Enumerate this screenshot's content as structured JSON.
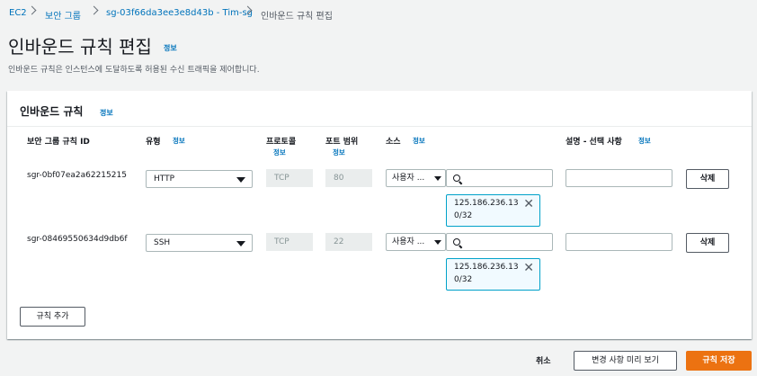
{
  "breadcrumb": {
    "items": [
      "EC2",
      "보안 그룹",
      "sg-03f66da3ee3e8d43b - Tim-sg"
    ],
    "current": "인바운드 규칙 편집"
  },
  "page": {
    "title": "인바운드 규칙 편집",
    "info": "정보",
    "description": "인바운드 규칙은 인스턴스에 도달하도록 허용된 수신 트래픽을 제어합니다."
  },
  "panel": {
    "title": "인바운드 규칙",
    "info": "정보",
    "columns": {
      "rule_id": "보안 그룹 규칙 ID",
      "type": "유형",
      "protocol": "프로토콜",
      "port": "포트 범위",
      "source": "소스",
      "description": "설명 - 선택 사항",
      "info": "정보"
    },
    "rules": [
      {
        "id": "sgr-0bf07ea2a62215215",
        "type": "HTTP",
        "protocol": "TCP",
        "port": "80",
        "source_type": "사용자 ...",
        "source_ip_line1": "125.186.236.13",
        "source_ip_line2": "0/32",
        "description": "",
        "delete_label": "삭제"
      },
      {
        "id": "sgr-08469550634d9db6f",
        "type": "SSH",
        "protocol": "TCP",
        "port": "22",
        "source_type": "사용자 ...",
        "source_ip_line1": "125.186.236.13",
        "source_ip_line2": "0/32",
        "description": "",
        "delete_label": "삭제"
      }
    ],
    "add_rule_label": "규칙 추가"
  },
  "footer": {
    "cancel_label": "취소",
    "preview_label": "변경 사항 미리 보기",
    "save_label": "규칙 저장"
  },
  "colors": {
    "link": "#0073bb",
    "primary": "#ec7211",
    "token_border": "#00a1c9"
  }
}
